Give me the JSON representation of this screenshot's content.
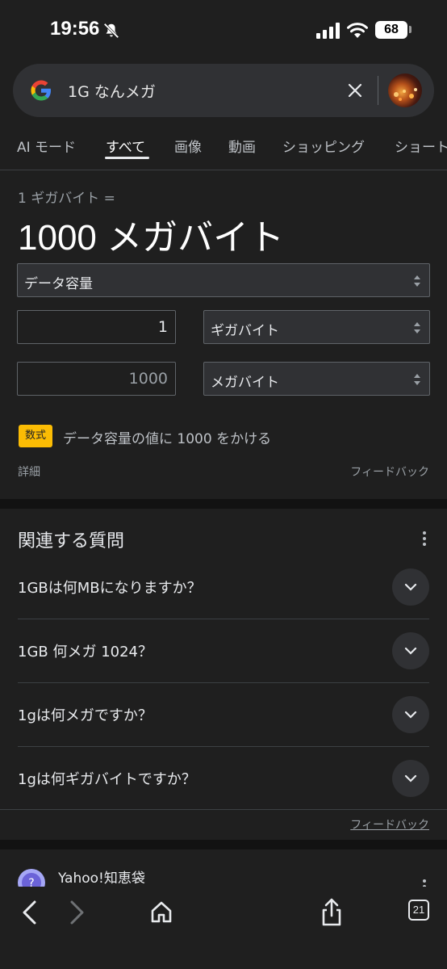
{
  "status": {
    "time": "19:56",
    "battery": "68"
  },
  "search": {
    "query": "1G なんメガ"
  },
  "tabs": [
    {
      "label": "AI モード"
    },
    {
      "label": "すべて",
      "active": true
    },
    {
      "label": "画像"
    },
    {
      "label": "動画"
    },
    {
      "label": "ショッピング"
    },
    {
      "label": "ショート"
    }
  ],
  "converter": {
    "equation": "1 ギガバイト =",
    "result": "1000 メガバイト",
    "category": "データ容量",
    "from_value": "1",
    "from_unit": "ギガバイト",
    "to_value": "1000",
    "to_unit": "メガバイト",
    "formula_badge": "数式",
    "formula_text": "データ容量の値に 1000 をかける",
    "details": "詳細",
    "feedback": "フィードバック"
  },
  "related_questions": {
    "title": "関連する質問",
    "items": [
      {
        "text": "1GBは何MBになりますか？"
      },
      {
        "text": "1GB 何メガ 1024？"
      },
      {
        "text": "1gは何メガですか？"
      },
      {
        "text": "1gは何ギガバイトですか？"
      }
    ],
    "feedback": "フィードバック"
  },
  "result": {
    "source": "Yahoo!知恵袋"
  },
  "toolbar": {
    "tab_count": "21"
  },
  "colors": {
    "background": "#1f1f1f",
    "surface": "#303134",
    "formula_badge": "#fbbc04"
  }
}
